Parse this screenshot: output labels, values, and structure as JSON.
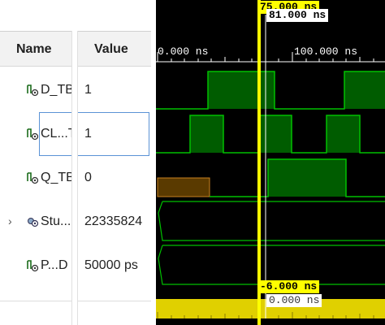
{
  "table": {
    "header_name": "Name",
    "header_value": "Value",
    "rows": [
      {
        "name": "D_TB",
        "value": "1",
        "icon": "signal-icon"
      },
      {
        "name": "CL...T",
        "value": "1",
        "icon": "signal-icon"
      },
      {
        "name": "Q_TB",
        "value": "0",
        "icon": "signal-icon"
      },
      {
        "name": "Stu...",
        "value": "22335824",
        "icon": "struct-icon",
        "expand": "›"
      },
      {
        "name": "P...D",
        "value": "50000 ps",
        "icon": "signal-icon"
      }
    ]
  },
  "timeline": {
    "tick_0": "0.000 ns",
    "tick_100": "100.000 ns",
    "cursor_primary": "75.000 ns",
    "cursor_secondary": "81.000 ns",
    "delta": "-6.000 ns",
    "bottom_label": "0.000 ns"
  },
  "colors": {
    "wave_green": "#00c000",
    "wave_fill": "#005c00",
    "unknown_fill": "#5a3a00",
    "cursor_yellow": "#ffff00"
  }
}
